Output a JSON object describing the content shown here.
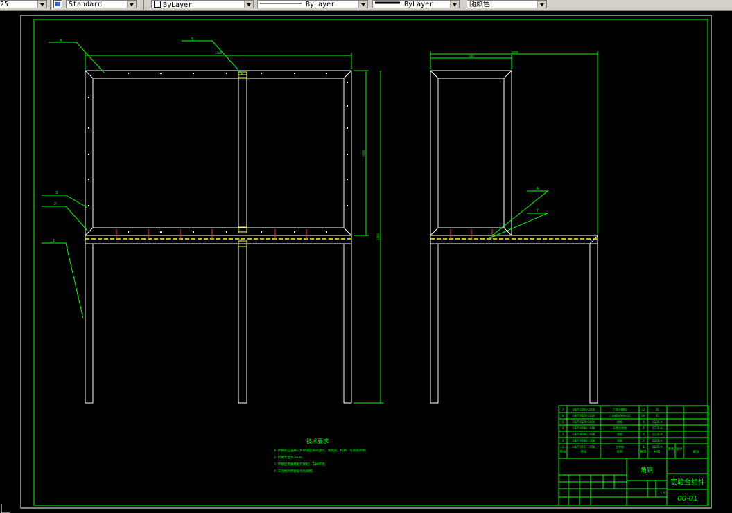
{
  "toolbar": {
    "textstyle_partial": "25",
    "dimstyle_value": "Standard",
    "layer_value": "ByLayer",
    "linetype_value": "ByLayer",
    "lineweight_value": "ByLayer",
    "plotstyle_value": "随颜色"
  },
  "colors": {
    "background": "#000000",
    "geometry": "#ffffff",
    "annotation": "#00ff00",
    "highlight": "#ffff00",
    "marker": "#ff3030"
  },
  "callouts": [
    "1",
    "2",
    "3",
    "4",
    "5",
    "6",
    "7"
  ],
  "dimensions": {
    "front_width": "1500",
    "front_panel": "1000",
    "front_height": "1800",
    "side_width": "1000",
    "side_top": "500"
  },
  "tech_notes": {
    "title": "技术要求",
    "lines": [
      "1. 焊接前应去掉工件焊缝区域的油污、氧化皮、铁锈、毛刺等杂物；",
      "2. 焊角高度为3mm；",
      "3. 焊接后需要打磨焊接处；去掉焊渣；",
      "4. 未注明的焊接处均为满焊。"
    ]
  },
  "bom_rows": [
    {
      "no": "7",
      "code": "GB/T 5783-2000",
      "name": "六角头螺栓",
      "qty": "32",
      "material": "35"
    },
    {
      "no": "6",
      "code": "GB/T 6170-2000",
      "name": "六角螺母M8×12",
      "qty": "16",
      "material": "35"
    },
    {
      "no": "5",
      "code": "GB/T 6170-2000",
      "name": "角钢",
      "qty": "4",
      "material": "Q235-A"
    },
    {
      "no": "4",
      "code": "GB/T 9788-1988",
      "name": "不等边角钢",
      "qty": "4",
      "material": "Q235-A"
    },
    {
      "no": "3",
      "code": "GB/T 9788-1988",
      "name": "角钢",
      "qty": "4",
      "material": "Q235-A"
    },
    {
      "no": "2",
      "code": "GB/T 9788-1988",
      "name": "角钢",
      "qty": "2",
      "material": "Q235-A"
    },
    {
      "no": "1",
      "code": "GB/T 9787-1988",
      "name": "工字钢",
      "qty": "4",
      "material": "Q235-A"
    }
  ],
  "bom_header": [
    "序号",
    "代号",
    "名称",
    "数量",
    "材料",
    "单件",
    "总计",
    "备注"
  ],
  "title_block": {
    "material": "角钢",
    "part_name": "实验台组件",
    "drawing_no": "00-01",
    "scale": "1:5"
  }
}
